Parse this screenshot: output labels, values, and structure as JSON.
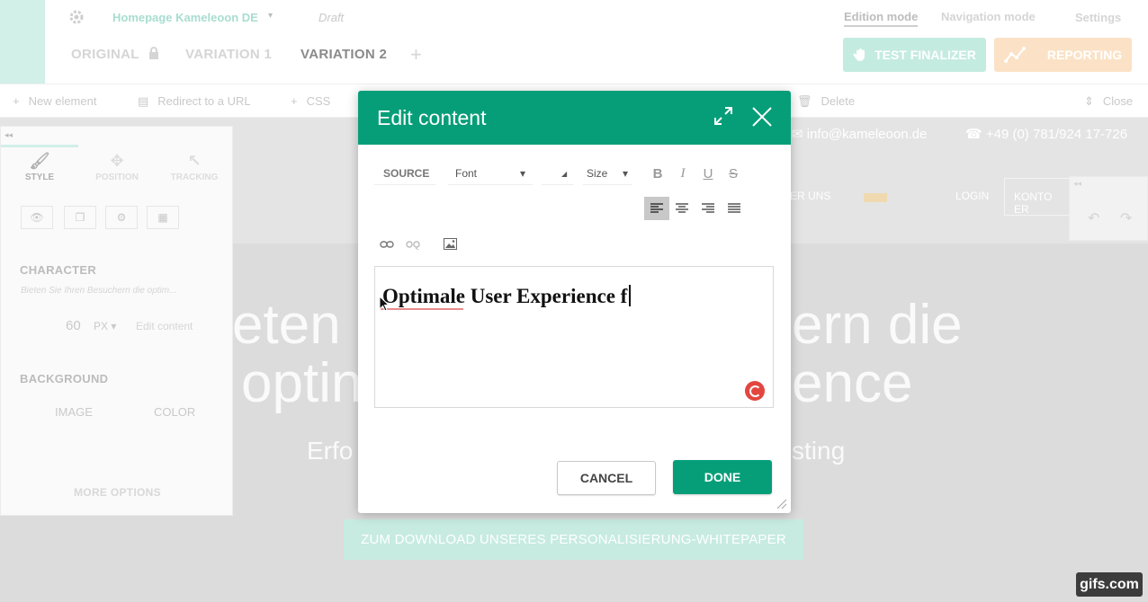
{
  "header": {
    "project_title": "Homepage Kameleoon DE",
    "status": "Draft",
    "modes": [
      "Edition mode",
      "Navigation mode",
      "Settings"
    ],
    "tabs": [
      "ORIGINAL",
      "VARIATION 1",
      "VARIATION 2"
    ],
    "active_tab": "VARIATION 2",
    "test_finalizer_label": "TEST FINALIZER",
    "reporting_label": "REPORTING"
  },
  "toolbar": {
    "new_element": "New element",
    "redirect": "Redirect to a URL",
    "css": "CSS",
    "delete": "Delete",
    "close": "Close"
  },
  "site": {
    "email": "info@kameleoon.de",
    "phone": "+49 (0) 781/924 17-726",
    "nav_item": "ER UNS",
    "login": "LOGIN",
    "konto": "KONTO ER",
    "hero_line1_left": "eten",
    "hero_line1_right": "ern die",
    "hero_line2_left": "optin",
    "hero_line2_right": "ence",
    "hero_sub_left": "Erfo",
    "hero_sub_right": "sting",
    "download_label": "ZUM DOWNLOAD UNSERES PERSONALISIERUNG-WHITEPAPER"
  },
  "left_panel": {
    "tabs": [
      "STYLE",
      "POSITION",
      "TRACKING"
    ],
    "character_label": "CHARACTER",
    "sample_text": "Bieten Sie Ihren Besuchern die optim...",
    "font_size": "60",
    "font_unit": "PX",
    "edit_content_label": "Edit content",
    "background_label": "BACKGROUND",
    "image_label": "IMAGE",
    "color_label": "COLOR",
    "more_options": "MORE OPTIONS"
  },
  "modal": {
    "title": "Edit content",
    "source_label": "SOURCE",
    "font_label": "Font",
    "size_label": "Size",
    "editor_text": "Optimale User Experience f",
    "cancel_label": "CANCEL",
    "done_label": "DONE"
  },
  "watermark": "gifs.com",
  "colors": {
    "accent_green": "#069e79",
    "faded_green": "#c4ebe0",
    "faded_orange": "#fbe2c6",
    "grammar_red": "#e2463f"
  }
}
